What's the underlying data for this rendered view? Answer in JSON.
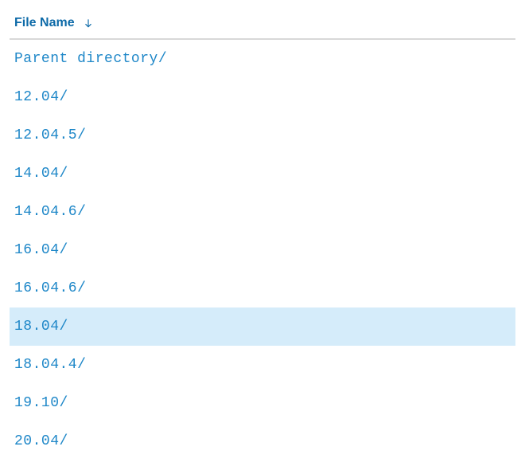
{
  "listing": {
    "header": {
      "file_name_label": "File Name",
      "sort_direction": "asc"
    },
    "rows": [
      {
        "name": "Parent directory/",
        "highlighted": false
      },
      {
        "name": "12.04/",
        "highlighted": false
      },
      {
        "name": "12.04.5/",
        "highlighted": false
      },
      {
        "name": "14.04/",
        "highlighted": false
      },
      {
        "name": "14.04.6/",
        "highlighted": false
      },
      {
        "name": "16.04/",
        "highlighted": false
      },
      {
        "name": "16.04.6/",
        "highlighted": false
      },
      {
        "name": "18.04/",
        "highlighted": true
      },
      {
        "name": "18.04.4/",
        "highlighted": false
      },
      {
        "name": "19.10/",
        "highlighted": false
      },
      {
        "name": "20.04/",
        "highlighted": false
      }
    ]
  }
}
